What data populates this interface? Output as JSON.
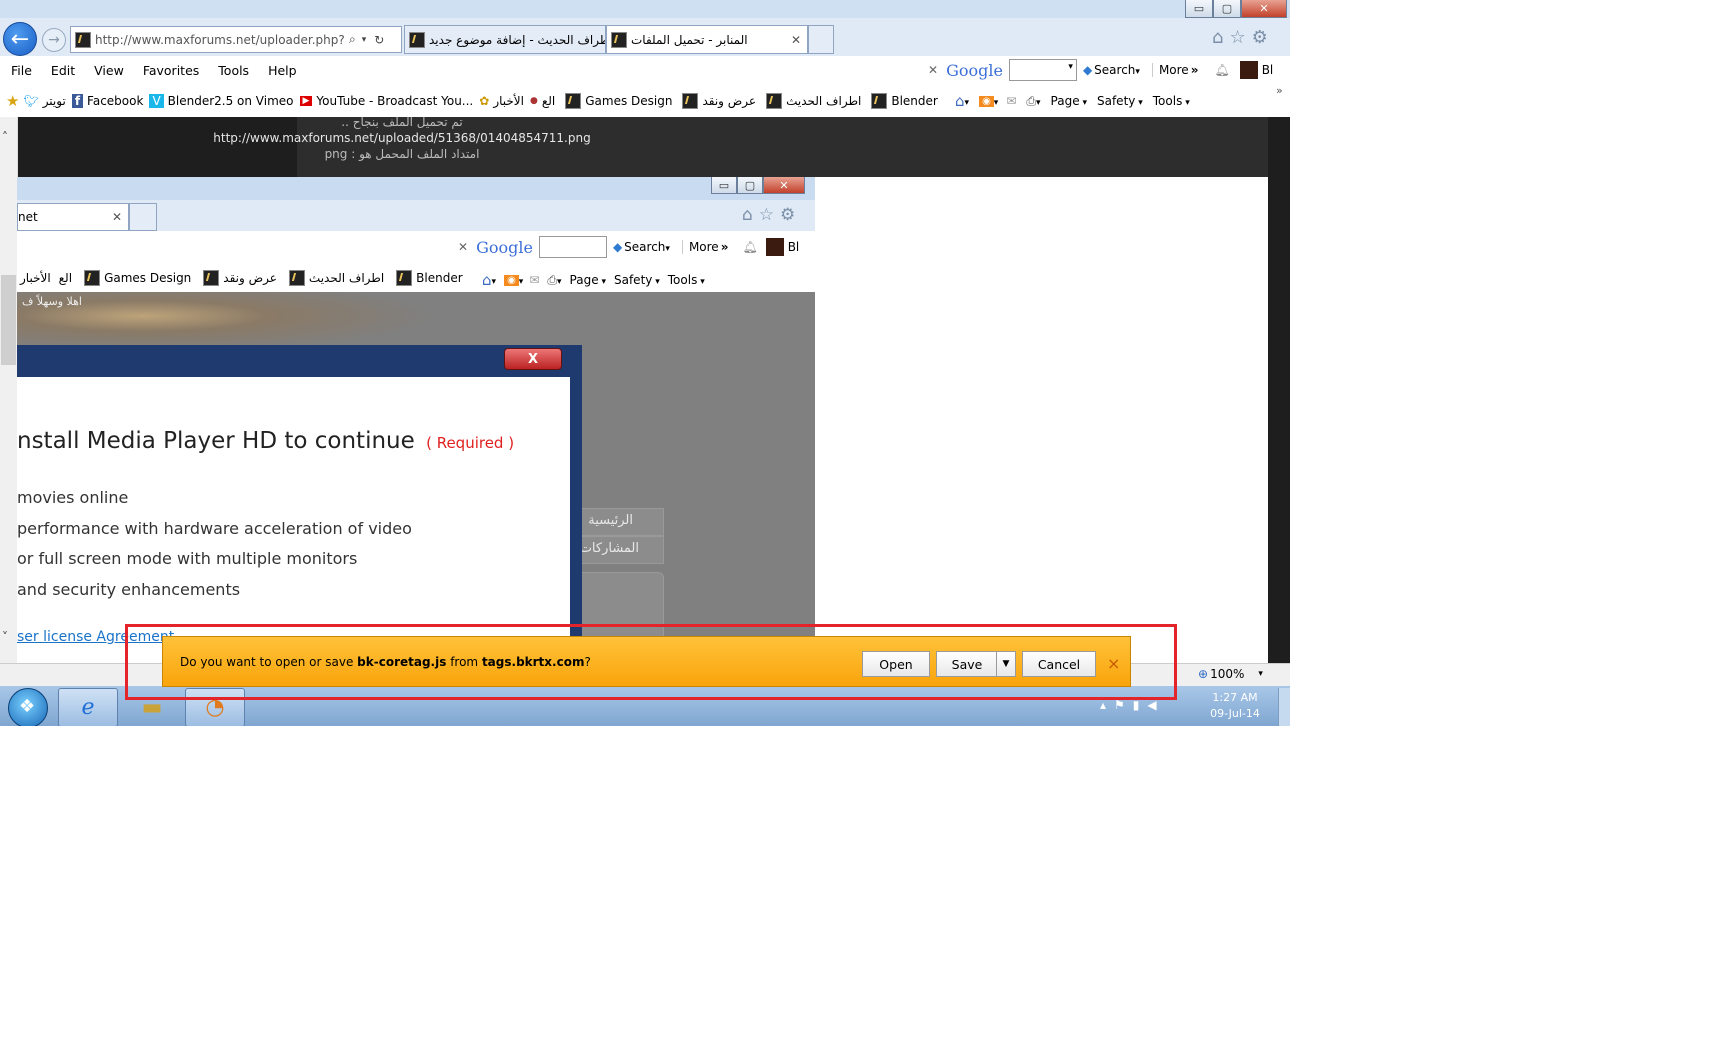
{
  "window": {
    "minimize": "▭",
    "restore": "▢",
    "close": "✕"
  },
  "nav": {
    "address": "http://www.maxforums.net/uploader.php?do=",
    "tabs": [
      {
        "label": "اطراف الحديث - إضافة موضوع جديد",
        "active": false
      },
      {
        "label": "المنابر - تحميل الملفات",
        "active": true
      }
    ]
  },
  "menu": [
    "File",
    "Edit",
    "View",
    "Favorites",
    "Tools",
    "Help"
  ],
  "google_bar": {
    "close": "✕",
    "logo": "Google",
    "search": "Search",
    "more": "More",
    "more_glyph": "»",
    "user": "Bl"
  },
  "favorites": [
    {
      "label": "تويتر"
    },
    {
      "label": "Facebook"
    },
    {
      "label": "Blender2.5 on Vimeo"
    },
    {
      "label": "YouTube - Broadcast You..."
    },
    {
      "label": "الأخبار"
    },
    {
      "label": "الع"
    },
    {
      "label": "Games Design"
    },
    {
      "label": "عرض ونقد"
    },
    {
      "label": "اطراف الحديث"
    },
    {
      "label": "Blender"
    }
  ],
  "commands": {
    "page": "Page",
    "safety": "Safety",
    "tools": "Tools",
    "chevron": "»"
  },
  "upload_info": {
    "line1": "تم تحميل الملف بنجاح ..",
    "url": "http://www.maxforums.net/uploaded/51368/01404854711.png",
    "line3": "امتداد الملف المحمل هو : png"
  },
  "nested": {
    "tab_label": "net",
    "google": {
      "logo": "Google",
      "search": "Search",
      "more": "More",
      "user": "Bl"
    },
    "favorites": [
      "الأخبار",
      "الع",
      "Games Design",
      "عرض ونقد",
      "اطراف الحديث",
      "Blender"
    ],
    "commands": {
      "page": "Page",
      "safety": "Safety",
      "tools": "Tools"
    },
    "greeting": "اهلا وسهلاً  ف",
    "side_menu": [
      "الرئيسية",
      "المشاركات"
    ]
  },
  "dialog": {
    "close": "X",
    "heading": "nstall Media Player HD to continue",
    "required": "( Required )",
    "bullets": [
      "movies online",
      "performance with hardware acceleration of video",
      "or full screen mode with multiple monitors",
      "and security enhancements"
    ],
    "license_link": "ser license Agreement"
  },
  "notification": {
    "prefix": "Do you want to open or save ",
    "filename": "bk-coretag.js",
    "middle": " from ",
    "host": "tags.bkrtx.com",
    "suffix": "?",
    "open": "Open",
    "save": "Save",
    "cancel": "Cancel",
    "close": "×"
  },
  "status": {
    "zoom": "100%"
  },
  "taskbar": {
    "time": "1:27 AM",
    "date": "09-Jul-14"
  },
  "colors": {
    "notification": "#f9a40b",
    "highlight": "#e4242b",
    "required": "#e02020",
    "link": "#1a73c9"
  }
}
